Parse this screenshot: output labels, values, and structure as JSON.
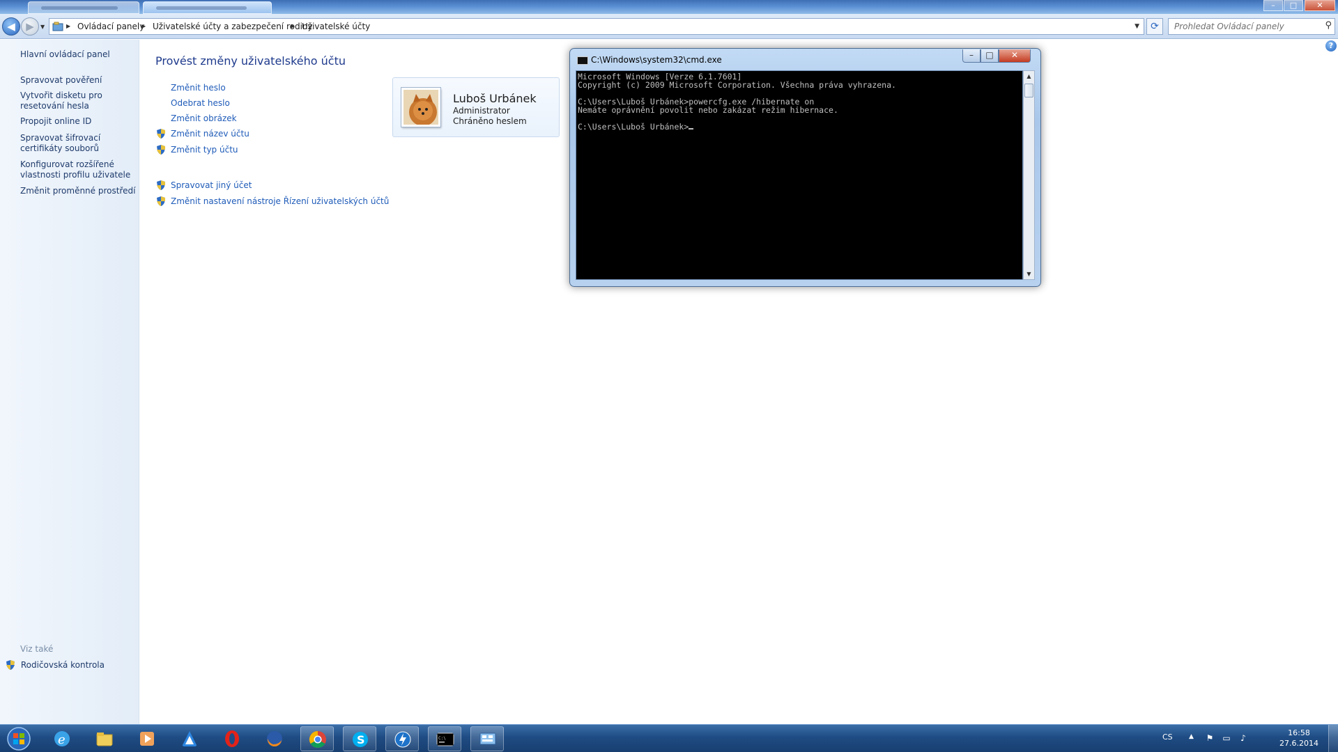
{
  "colors": {
    "link": "#1e5bb8",
    "title_accent": "#1e3a8c",
    "taskbar": "#1f4c84",
    "console_bg": "#000000",
    "console_fg": "#c0c0c0"
  },
  "window": {
    "caption_buttons": {
      "minimize": "–",
      "maximize": "□",
      "close": "✕"
    }
  },
  "address": {
    "back": "◀",
    "forward": "▶",
    "crumbs": [
      "Ovládací panely",
      "Uživatelské účty a zabezpečení rodiny",
      "Uživatelské účty"
    ],
    "refresh": "⟳"
  },
  "search": {
    "placeholder": "Prohledat Ovládací panely"
  },
  "left_pane": {
    "home": "Hlavní ovládací panel",
    "links": [
      "Spravovat pověření",
      "Vytvořit disketu pro resetování hesla",
      "Propojit online ID",
      "Spravovat šifrovací certifikáty souborů",
      "Konfigurovat rozšířené vlastnosti profilu uživatele",
      "Změnit proměnné prostředí"
    ],
    "see_also": "Viz také",
    "parental": "Rodičovská kontrola"
  },
  "main": {
    "title": "Provést změny uživatelského účtu",
    "tasks": [
      {
        "label": "Změnit heslo",
        "shield": false
      },
      {
        "label": "Odebrat heslo",
        "shield": false
      },
      {
        "label": "Změnit obrázek",
        "shield": false
      },
      {
        "label": "Změnit název účtu",
        "shield": true
      },
      {
        "label": "Změnit typ účtu",
        "shield": true
      }
    ],
    "tasks2": [
      {
        "label": "Spravovat jiný účet",
        "shield": true
      },
      {
        "label": "Změnit nastavení nástroje Řízení uživatelských účtů",
        "shield": true
      }
    ],
    "user": {
      "name": "Luboš Urbánek",
      "role": "Administrator",
      "protection": "Chráněno heslem"
    }
  },
  "cmd": {
    "title": "C:\\Windows\\system32\\cmd.exe",
    "lines": [
      "Microsoft Windows [Verze 6.1.7601]",
      "Copyright (c) 2009 Microsoft Corporation. Všechna práva vyhrazena.",
      "",
      "C:\\Users\\Luboš Urbánek>powercfg.exe /hibernate on",
      "Nemáte oprávnění povolit nebo zakázat režim hibernace.",
      "",
      "C:\\Users\\Luboš Urbánek>"
    ]
  },
  "taskbar": {
    "apps": [
      "internet-explorer",
      "file-explorer",
      "media-player",
      "app-store",
      "opera",
      "firefox",
      "chrome",
      "skype",
      "thunder-app",
      "cmd",
      "control-panel"
    ],
    "lang": "CS",
    "time": "16:58",
    "date": "27.6.2014"
  }
}
